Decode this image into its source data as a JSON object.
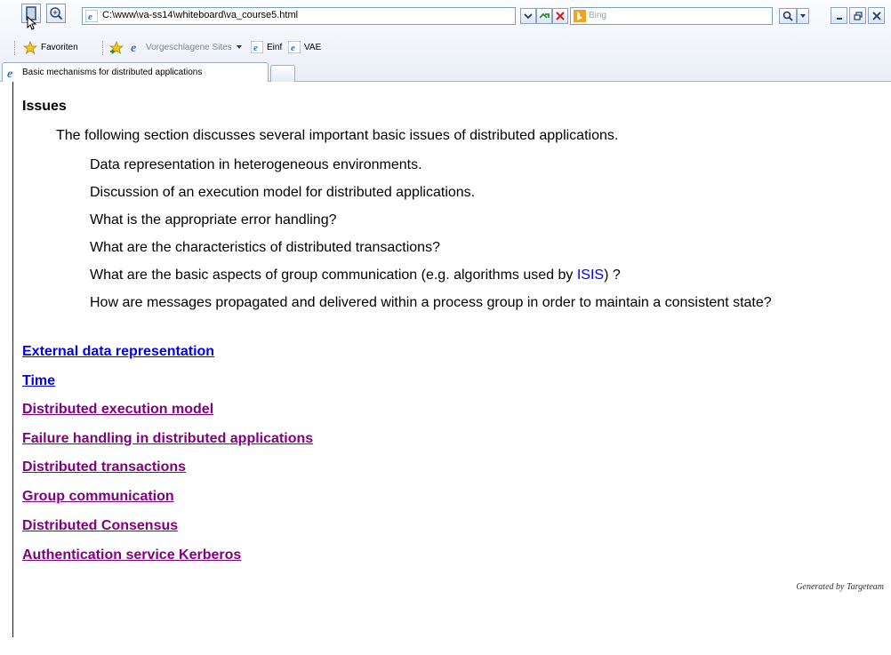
{
  "browser": {
    "address": "C:\\www\\va-ss14\\whiteboard\\va_course5.html",
    "search_placeholder": "Bing",
    "favorites_label": "Favoriten",
    "suggested_sites_label": "Vorgeschlagene Sites",
    "fav_links": [
      "Einf",
      "VAE"
    ],
    "tab_title": "Basic mechanisms for distributed applications",
    "accent_color": "#7f9db9"
  },
  "page": {
    "heading": "Issues",
    "intro": "The following section discusses several important basic issues of distributed applications.",
    "issues": [
      "Data representation in heterogeneous environments.",
      "Discussion of an execution model for distributed applications.",
      "What is the appropriate error handling?",
      "What are the characteristics of distributed transactions?",
      "What are the basic aspects of group communication (e.g. algorithms used by ",
      "How are messages propagated and delivered within a process group in order to maintain a consistent state?"
    ],
    "isis_link": "ISIS",
    "isis_suffix": ") ?",
    "links": [
      {
        "label": "External data representation",
        "visited": false
      },
      {
        "label": "Time",
        "visited": false
      },
      {
        "label": "Distributed execution model",
        "visited": true
      },
      {
        "label": "Failure handling in distributed applications",
        "visited": true
      },
      {
        "label": "Distributed transactions",
        "visited": true
      },
      {
        "label": "Group communication",
        "visited": true
      },
      {
        "label": "Distributed Consensus",
        "visited": true
      },
      {
        "label": "Authentication service Kerberos",
        "visited": true
      }
    ],
    "footer": "Generated by Targeteam"
  }
}
